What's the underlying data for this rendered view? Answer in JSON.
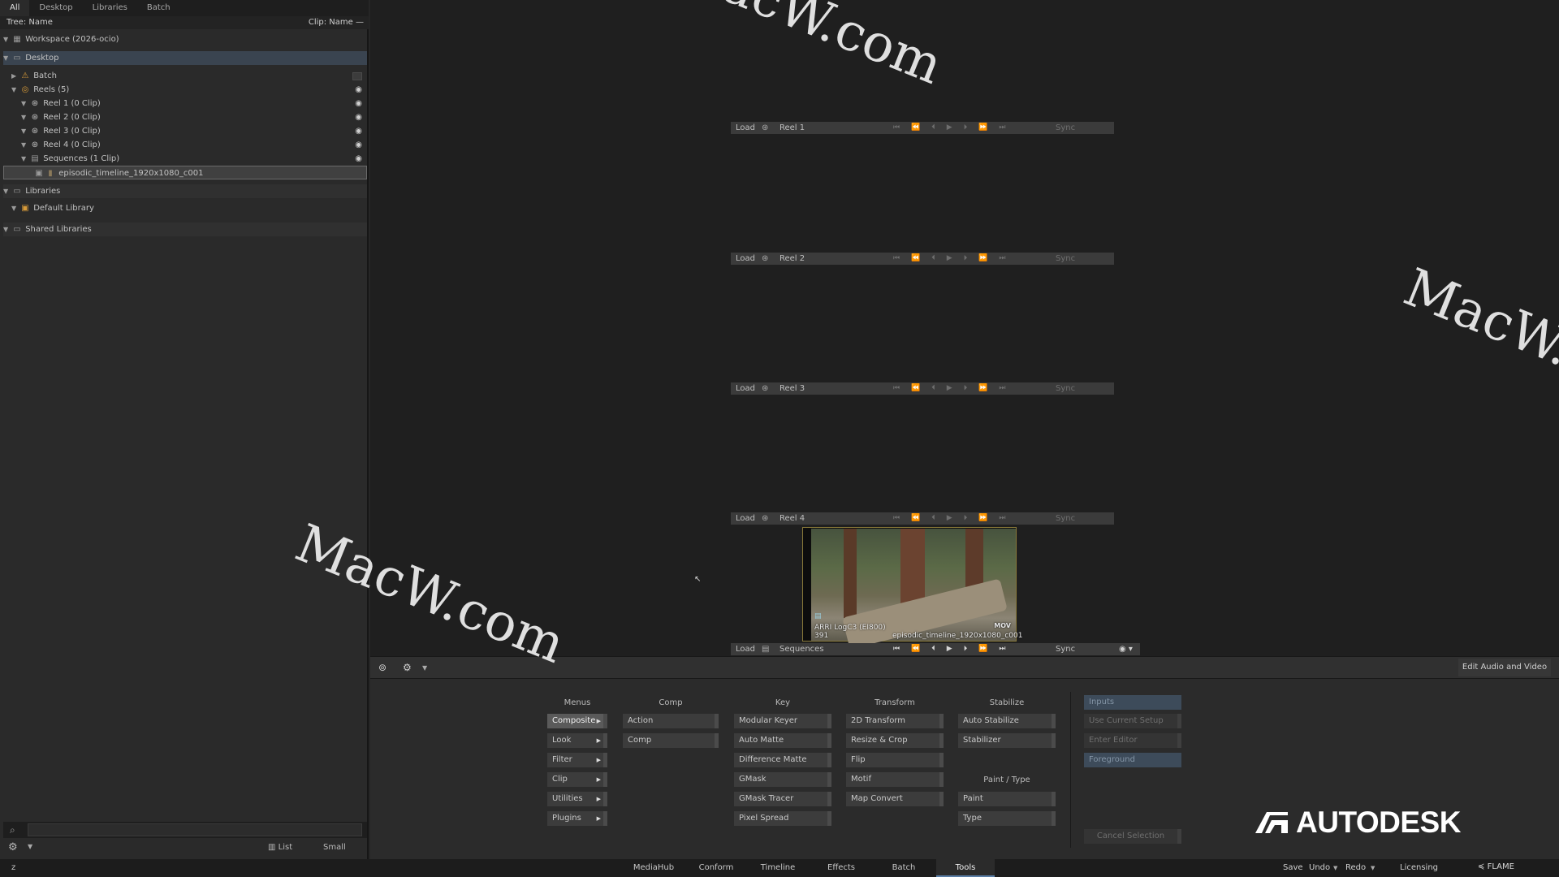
{
  "left_panel": {
    "tabs": [
      "All",
      "Desktop",
      "Libraries",
      "Batch"
    ],
    "tree_header": {
      "left": "Tree: Name",
      "right": "Clip: Name —"
    },
    "rows": {
      "workspace": "Workspace (2026-ocio)",
      "desktop": "Desktop",
      "batch": "Batch",
      "reels": "Reels (5)",
      "reel1": "Reel 1 (0 Clip)",
      "reel2": "Reel 2 (0 Clip)",
      "reel3": "Reel 3 (0 Clip)",
      "reel4": "Reel 4 (0 Clip)",
      "sequences": "Sequences (1 Clip)",
      "clip": "episodic_timeline_1920x1080_c001",
      "libraries": "Libraries",
      "default_library": "Default Library",
      "shared_libraries": "Shared Libraries"
    },
    "footer": {
      "list_label": "List",
      "size_label": "Small"
    }
  },
  "viewer": {
    "load_label": "Load",
    "sync_label": "Sync",
    "reels": [
      "Reel 1",
      "Reel 2",
      "Reel 3",
      "Reel 4",
      "Sequences"
    ],
    "thumbnail": {
      "colorspace": "ARRI LogC3 (EI800)",
      "frames": "391",
      "name": "episodic_timeline_1920x1080_c001",
      "format": "MOV"
    }
  },
  "midbar": {
    "edit_av_label": "Edit Audio and Video"
  },
  "tools": {
    "headers": {
      "menus": "Menus",
      "comp": "Comp",
      "key": "Key",
      "transform": "Transform",
      "stabilize": "Stabilize",
      "paint_type": "Paint / Type"
    },
    "menus": [
      "Composite",
      "Look",
      "Filter",
      "Clip",
      "Utilities",
      "Plugins"
    ],
    "comp": [
      "Action",
      "Comp"
    ],
    "key": [
      "Modular Keyer",
      "Auto Matte",
      "Difference Matte",
      "GMask",
      "GMask Tracer",
      "Pixel Spread"
    ],
    "transform": [
      "2D Transform",
      "Resize & Crop",
      "Flip",
      "Motif",
      "Map Convert"
    ],
    "stabilize": [
      "Auto Stabilize",
      "Stabilizer"
    ],
    "paint_type": [
      "Paint",
      "Type"
    ],
    "side": [
      "Inputs",
      "Use Current Setup",
      "Enter Editor",
      "Foreground"
    ],
    "cancel_label": "Cancel Selection",
    "logo_text": "AUTODESK"
  },
  "status_bar": {
    "left_label": "z",
    "tabs": [
      "MediaHub",
      "Conform",
      "Timeline",
      "Effects",
      "Batch",
      "Tools"
    ],
    "save": "Save",
    "undo": "Undo",
    "redo": "Redo",
    "licensing": "Licensing",
    "product": "FLAME"
  },
  "watermark": "MacW.com"
}
